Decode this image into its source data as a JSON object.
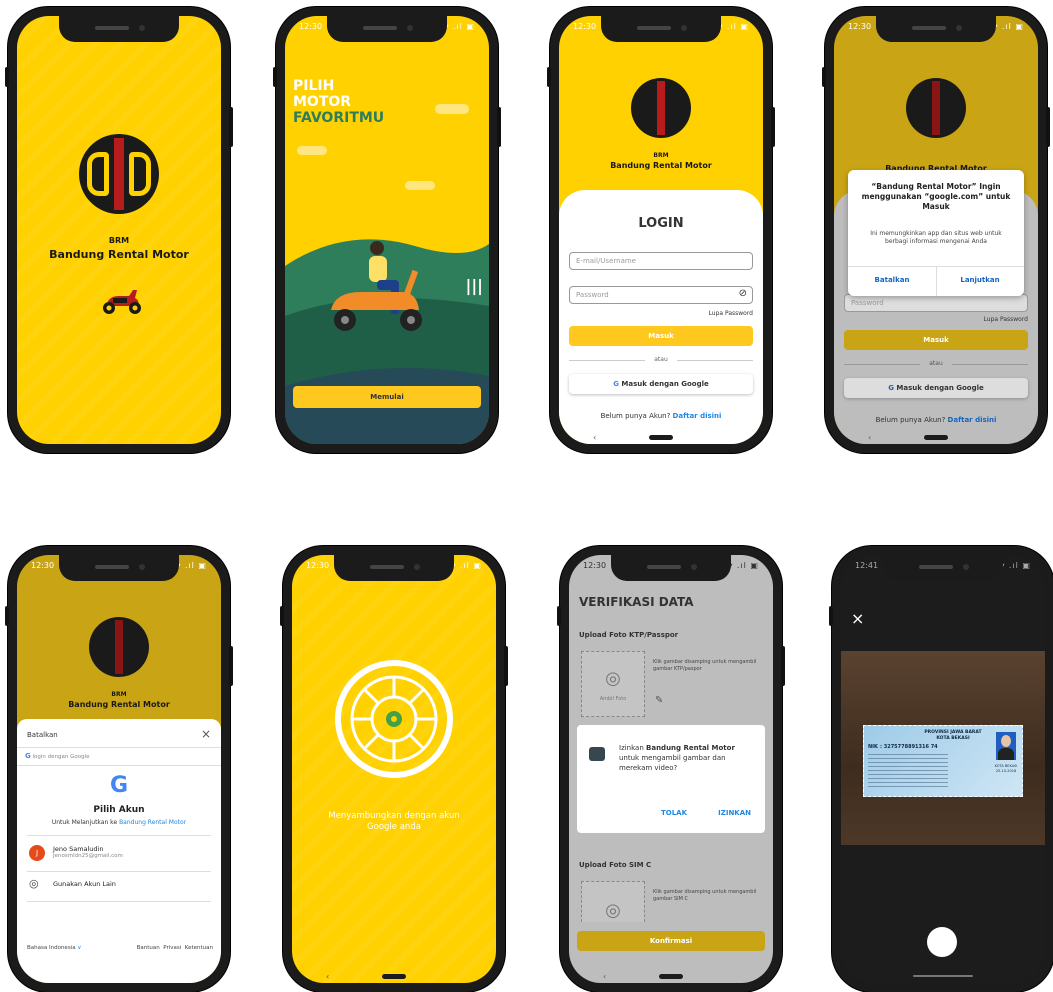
{
  "brand": {
    "short": "BRM",
    "name": "Bandung Rental Motor",
    "accent": "#FFD100",
    "button": "#FFC81E",
    "logo_red": "#B71C1C"
  },
  "status": {
    "time": "12:30",
    "icons": "▾ .ıl ▣"
  },
  "onboard": {
    "title_l1": "PILIH",
    "title_l2": "MOTOR",
    "title_l3": "FAVORITMU",
    "button": "Memulai"
  },
  "login": {
    "title": "LOGIN",
    "email_placeholder": "E-mail/Username",
    "password_placeholder": "Password",
    "forgot": "Lupa Password",
    "submit": "Masuk",
    "or": "atau",
    "google": "Masuk dengan Google",
    "no_account": "Belum punya Akun?",
    "register": "Daftar disini"
  },
  "dialog": {
    "title": "“Bandung Rental Motor” Ingin menggunakan “google.com” untuk Masuk",
    "body": "Ini memungkinkan app dan situs web untuk berbagi informasi mengenai Anda",
    "cancel": "Batalkan",
    "continue": "Lanjutkan"
  },
  "account": {
    "cancel": "Batalkan",
    "search": "login dengan Google",
    "title": "Pilih Akun",
    "subtitle": "Untuk Melanjutkan ke",
    "subtitle_link": "Bandung Rental Motor",
    "user_initial": "J",
    "user_name": "Jeno Samaludin",
    "user_email": "Jenosmldn25@gmail.com",
    "other": "Gunakan Akun Lain",
    "language": "Bahasa Indonesia",
    "help": "Bantuan",
    "privacy": "Privasi",
    "terms": "Ketentuan"
  },
  "connecting": {
    "text": "Menyambungkan dengan akun Google anda"
  },
  "verify": {
    "title": "VERIFIKASI DATA",
    "ktp_label": "Upload Foto KTP/Passpor",
    "ktp_hint": "Klik gambar disamping untuk mengambil gambar KTP/paspor",
    "photo_label": "Ambil Foto",
    "perm_pre": "Izinkan",
    "perm_app": "Bandung Rental Motor",
    "perm_post": "untuk mengambil gambar dan merekam video?",
    "deny": "TOLAK",
    "allow": "IZINKAN",
    "sim_label": "Upload Foto SIM C",
    "sim_hint": "Klik gambar disamping untuk mengambil gambar SIM C",
    "confirm": "Konfirmasi"
  },
  "camera": {
    "time": "12:41",
    "close": "×",
    "id_province": "PROVINSI JAWA BARAT",
    "id_city": "KOTA BEKASI",
    "id_nik_label": "NIK",
    "id_nik": ": 3275778891316 74",
    "id_place": "KOTA BEKASI",
    "id_date": "25-10-2018"
  }
}
